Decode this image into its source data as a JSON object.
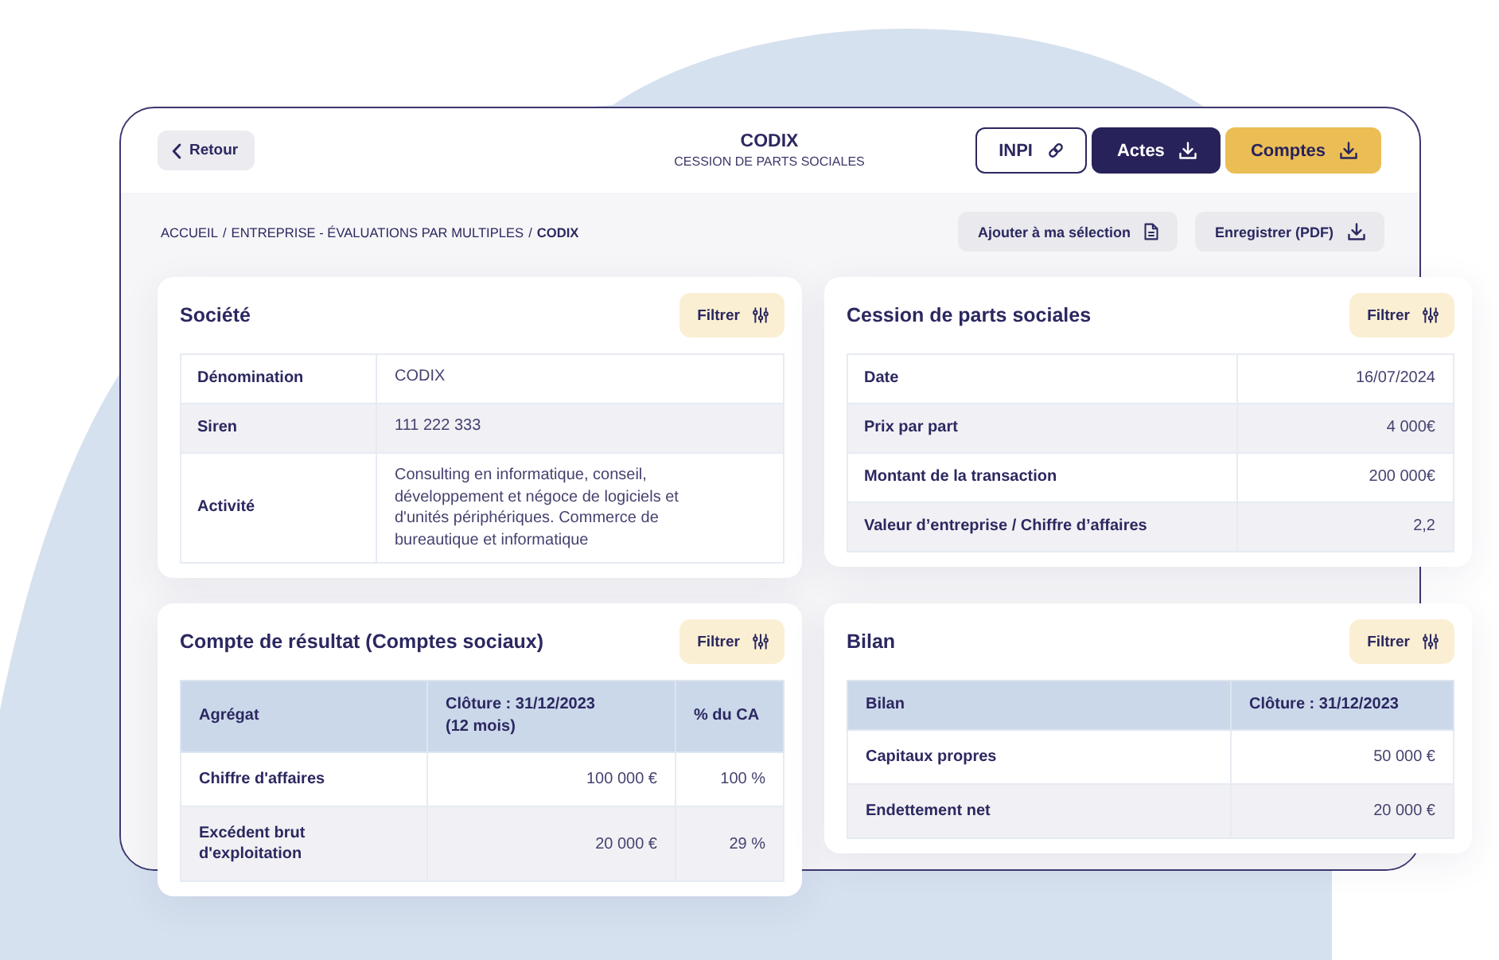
{
  "header": {
    "back_button": "Retour",
    "title": "CODIX",
    "subtitle": "CESSION DE PARTS SOCIALES",
    "actions": [
      {
        "label": "INPI",
        "kind": "outline"
      },
      {
        "label": "Actes",
        "kind": "dark"
      },
      {
        "label": "Comptes",
        "kind": "accent"
      }
    ]
  },
  "breadcrumb": {
    "separator": "/",
    "items": [
      {
        "label": "ACCUEIL",
        "current": false
      },
      {
        "label": "ENTREPRISE - ÉVALUATIONS PAR MULTIPLES",
        "current": false
      },
      {
        "label": "CODIX",
        "current": true
      }
    ]
  },
  "toolbar": [
    {
      "label": "Ajouter à ma sélection",
      "kind": "add"
    },
    {
      "label": "Enregistrer (PDF)",
      "kind": "export"
    }
  ],
  "cards": [
    {
      "title": "Société",
      "filter_button": "Filtrer",
      "table": {
        "kind": "profile",
        "rows": [
          {
            "label": "Dénomination",
            "value": "CODIX"
          },
          {
            "label": "Siren",
            "value": "111 222 333"
          },
          {
            "label": "Activité",
            "value": "Consulting en informatique, conseil, développement et négoce de logiciels et d'unités périphériques. Commerce de bureautique et informatique"
          }
        ]
      }
    },
    {
      "title": "Cession de parts sociales",
      "filter_button": "Filtrer",
      "table": {
        "kind": "figures",
        "rows": [
          {
            "label": "Date",
            "value": "16/07/2024"
          },
          {
            "label": "Prix par part",
            "value": "4 000€"
          },
          {
            "label": "Montant de la transaction",
            "value": "200 000€"
          },
          {
            "label": "Valeur d’entreprise / Chiffre d’affaires",
            "value": "2,2"
          }
        ]
      }
    },
    {
      "title": "Compte de résultat (Comptes sociaux)",
      "filter_button": "Filtrer",
      "table": {
        "kind": "statement",
        "columns": [
          "Agrégat",
          "Clôture : 31/12/2023 (12 mois)",
          "% du CA"
        ],
        "rows": [
          {
            "cells": [
              "Chiffre d'affaires",
              "100 000 €",
              "100 %"
            ]
          },
          {
            "cells": [
              "Excédent brut d'exploitation",
              "20 000 €",
              "29 %"
            ]
          }
        ]
      }
    },
    {
      "title": "Bilan",
      "filter_button": "Filtrer",
      "table": {
        "kind": "statement",
        "columns": [
          "Bilan",
          "Clôture : 31/12/2023"
        ],
        "rows": [
          {
            "cells": [
              "Capitaux propres",
              "50 000 €"
            ]
          },
          {
            "cells": [
              "Endettement net",
              "20 000 €"
            ]
          }
        ]
      }
    }
  ]
}
